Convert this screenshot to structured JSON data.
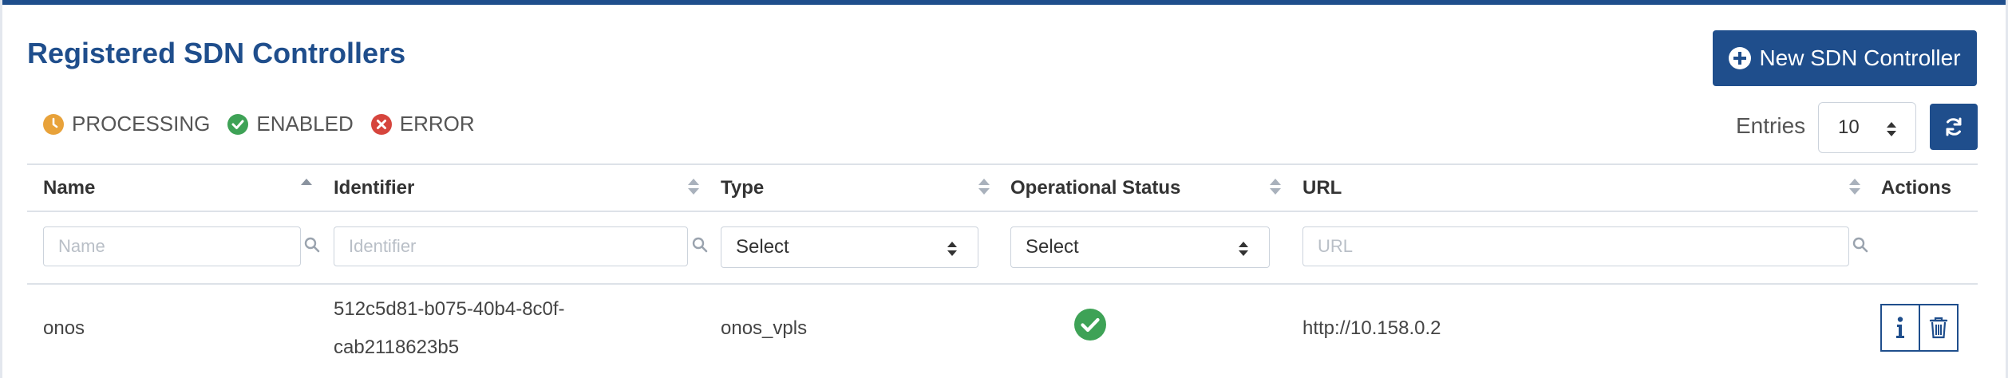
{
  "header": {
    "title": "Registered SDN Controllers",
    "new_button_label": "New SDN Controller"
  },
  "legend": [
    {
      "icon": "clock-icon",
      "label": "PROCESSING",
      "color": "#e8a23a"
    },
    {
      "icon": "check-circle-icon",
      "label": "ENABLED",
      "color": "#3ea256"
    },
    {
      "icon": "x-circle-icon",
      "label": "ERROR",
      "color": "#d6453d"
    }
  ],
  "entries": {
    "label": "Entries",
    "value": "10"
  },
  "table": {
    "columns": [
      "Name",
      "Identifier",
      "Type",
      "Operational Status",
      "URL",
      "Actions"
    ],
    "filters": {
      "name_placeholder": "Name",
      "identifier_placeholder": "Identifier",
      "type_select": "Select",
      "status_select": "Select",
      "url_placeholder": "URL"
    },
    "rows": [
      {
        "name": "onos",
        "identifier_line1": "512c5d81-b075-40b4-8c0f-",
        "identifier_line2": "cab2118623b5",
        "type": "onos_vpls",
        "status": "enabled",
        "url": "http://10.158.0.2"
      }
    ]
  },
  "colors": {
    "primary": "#1f4e8c",
    "enabled": "#3ea256",
    "processing": "#e8a23a",
    "error": "#d6453d"
  }
}
